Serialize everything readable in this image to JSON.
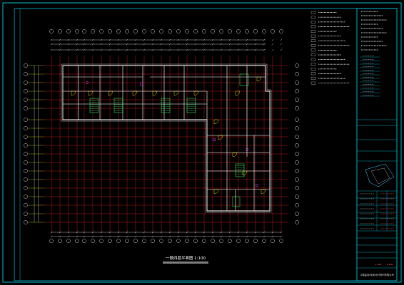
{
  "drawing": {
    "caption": "一段四层平面图 1:100",
    "colors": {
      "background": "#000000",
      "frame": "#00e5ff",
      "grid": "#c81e1e",
      "walls": "#ffffff",
      "axis": "#ffff00",
      "stair": "#33ff66",
      "accent": "#ff40ff"
    }
  },
  "title_block": {
    "company": "中鑫建设(深圳)设计顾问有限公司",
    "revisions": [
      "1:100",
      "1:100"
    ]
  }
}
